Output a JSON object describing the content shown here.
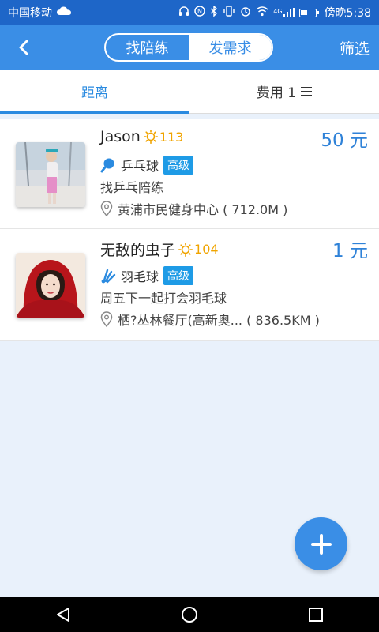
{
  "status_bar": {
    "carrier": "中国移动",
    "time_text": "傍晚5:38",
    "signal_label": "4G"
  },
  "header": {
    "segments": [
      "找陪练",
      "发需求"
    ],
    "active_segment": "发需求",
    "filter_label": "筛选"
  },
  "tabs": [
    {
      "label": "距离",
      "active": true
    },
    {
      "label": "费用 1",
      "active": false
    }
  ],
  "items": [
    {
      "name": "Jason",
      "points": "113",
      "price": "50 元",
      "sport": "乒乓球",
      "sport_icon": "ping-pong-paddle-icon",
      "level": "高级",
      "description": "找乒乓陪练",
      "location": "黄浦市民健身中心 ( 712.0M )"
    },
    {
      "name": "无敌的虫子",
      "points": "104",
      "price": "1 元",
      "sport": "羽毛球",
      "sport_icon": "shuttlecock-icon",
      "level": "高级",
      "description": "周五下一起打会羽毛球",
      "location": "栖?丛林餐厅(高新奥... ( 836.5KM )"
    }
  ],
  "colors": {
    "primary": "#3a8ee6",
    "status_bar": "#1e66c8",
    "price": "#2f82d8",
    "points": "#f0a400",
    "level_badge": "#1e9be6",
    "background": "#e9f1fb"
  }
}
